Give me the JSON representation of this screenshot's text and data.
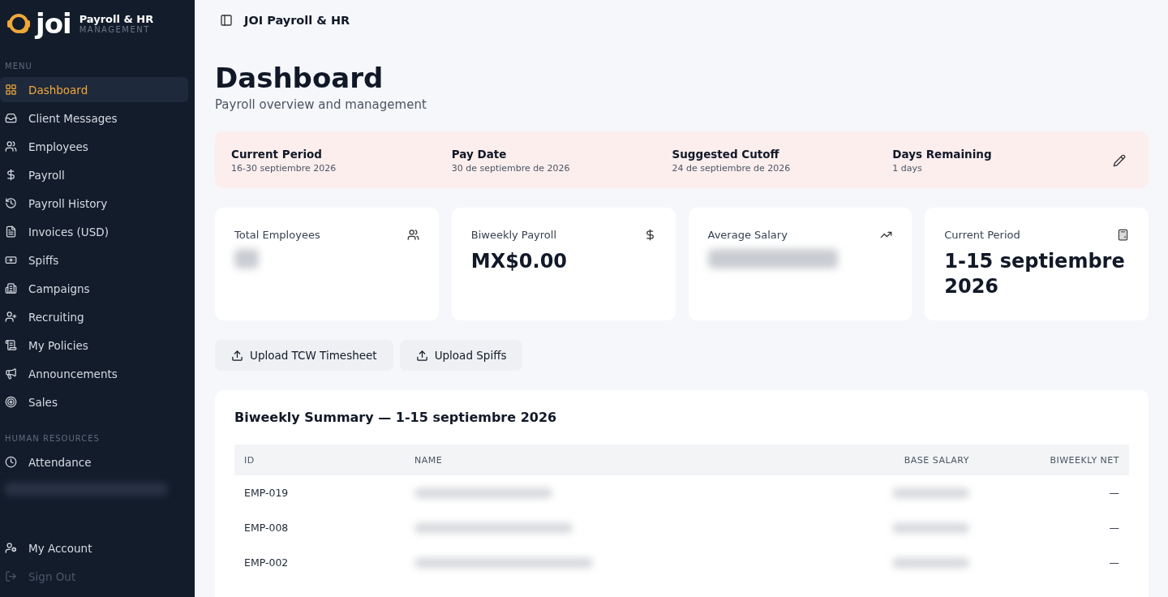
{
  "sidebar": {
    "logo": "joi",
    "app_title": "Payroll & HR",
    "app_subtitle": "MANAGEMENT",
    "sections": [
      {
        "heading": "MENU",
        "items": [
          {
            "label": "Dashboard",
            "selected": true
          },
          {
            "label": "Client Messages",
            "selected": false
          },
          {
            "label": "Employees",
            "selected": false
          },
          {
            "label": "Payroll",
            "selected": false
          },
          {
            "label": "Payroll History",
            "selected": false
          },
          {
            "label": "Invoices (USD)",
            "selected": false
          },
          {
            "label": "Spiffs",
            "selected": false
          },
          {
            "label": "Campaigns",
            "selected": false
          },
          {
            "label": "Recruiting",
            "selected": false
          },
          {
            "label": "My Policies",
            "selected": false
          },
          {
            "label": "Announcements",
            "selected": false
          },
          {
            "label": "Sales",
            "selected": false
          }
        ]
      },
      {
        "heading": "HUMAN RESOURCES",
        "items": [
          {
            "label": "Attendance",
            "selected": false
          }
        ]
      }
    ],
    "footer": [
      {
        "label": "My Account",
        "disabled": false
      },
      {
        "label": "Sign Out",
        "disabled": true
      }
    ]
  },
  "topbar": {
    "title": "JOI Payroll & HR"
  },
  "page": {
    "title": "Dashboard",
    "subtitle": "Payroll overview and management"
  },
  "period_banner": [
    {
      "label": "Current Period",
      "value": "16-30 septiembre 2026"
    },
    {
      "label": "Pay Date",
      "value": "30 de septiembre de 2026"
    },
    {
      "label": "Suggested Cutoff",
      "value": "24 de septiembre de 2026"
    },
    {
      "label": "Days Remaining",
      "value": "1 days"
    }
  ],
  "stats": [
    {
      "label": "Total Employees"
    },
    {
      "label": "Biweekly Payroll",
      "value": "MX$0.00"
    },
    {
      "label": "Average Salary"
    },
    {
      "label": "Current Period",
      "value": "1-15 septiembre 2026"
    }
  ],
  "actions": [
    "Upload TCW Timesheet",
    "Upload Spiffs"
  ],
  "summary": {
    "title": "Biweekly Summary — 1-15 septiembre 2026",
    "columns": [
      "ID",
      "NAME",
      "BASE SALARY",
      "BIWEEKLY NET"
    ],
    "rows": [
      {
        "id": "EMP-019",
        "net": "—"
      },
      {
        "id": "EMP-008",
        "net": "—"
      },
      {
        "id": "EMP-002",
        "net": "—"
      }
    ]
  }
}
